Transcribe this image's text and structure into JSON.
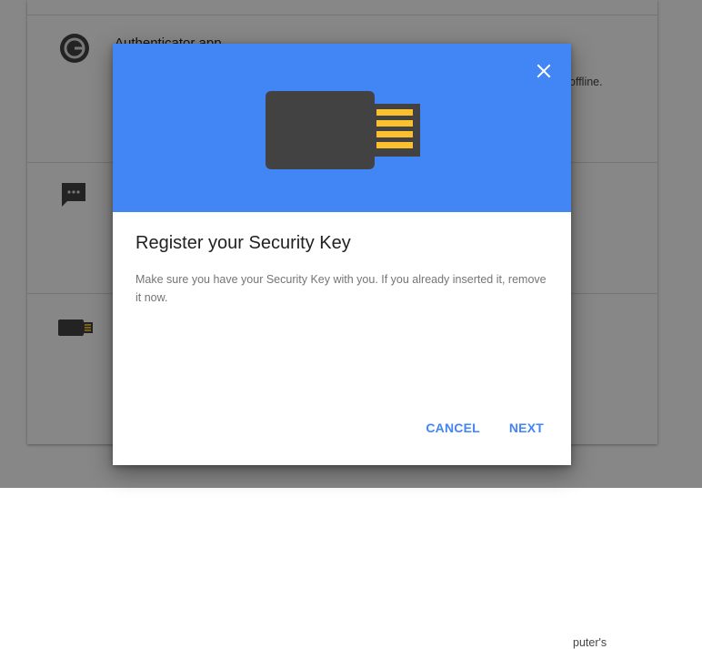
{
  "background": {
    "rows": [
      {
        "title": "Authenticator app",
        "side_text": "offline.",
        "icon": "authenticator-icon"
      },
      {
        "title": "",
        "side_text": "",
        "icon": "chat-bubble-icon"
      },
      {
        "title": "",
        "side_text": "puter's",
        "icon": "security-key-icon"
      }
    ]
  },
  "dialog": {
    "close_icon": "close-icon",
    "hero_icon": "security-key-icon",
    "title": "Register your Security Key",
    "body": "Make sure you have your Security Key with you. If you already inserted it, remove it now.",
    "actions": {
      "cancel": "CANCEL",
      "next": "NEXT"
    }
  },
  "colors": {
    "accent": "#4285f4",
    "key_body": "#424242",
    "key_contacts": "#fbc02d"
  }
}
